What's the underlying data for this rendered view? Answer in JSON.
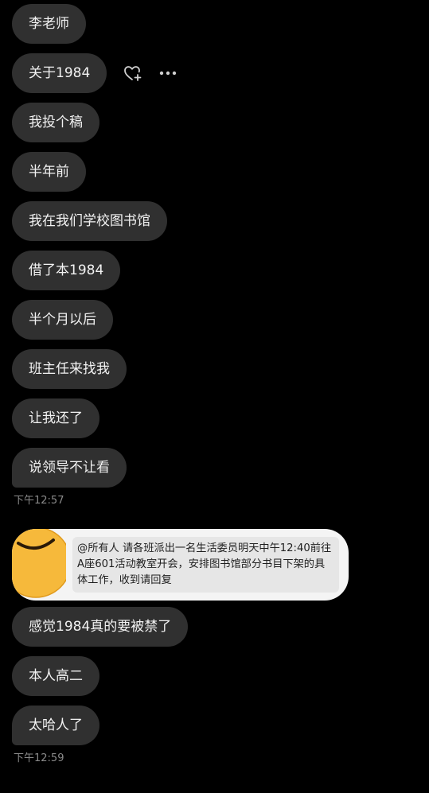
{
  "messages_group_1": [
    {
      "text": "李老师"
    },
    {
      "text": "关于1984"
    },
    {
      "text": "我投个稿"
    },
    {
      "text": "半年前"
    },
    {
      "text": "我在我们学校图书馆"
    },
    {
      "text": "借了本1984"
    },
    {
      "text": "半个月以后"
    },
    {
      "text": "班主任来找我"
    },
    {
      "text": "让我还了"
    },
    {
      "text": "说领导不让看"
    }
  ],
  "timestamp_1": "下午12:57",
  "quoted_notice": {
    "text": "@所有人  请各班派出一名生活委员明天中午12:40前往A座601活动教室开会，安排图书馆部分书目下架的具体工作，收到请回复"
  },
  "messages_group_2": [
    {
      "text": "感觉1984真的要被禁了"
    },
    {
      "text": "本人高二"
    },
    {
      "text": "太哈人了"
    }
  ],
  "timestamp_2": "下午12:59",
  "actions": {
    "like_icon": "heart-plus-icon",
    "more_icon": "more-dots-icon"
  },
  "colors": {
    "background": "#000000",
    "bubble": "#303030",
    "bubble_text": "#f2f2f2",
    "timestamp": "#8a8a8a",
    "quote_card": "#f4f4f4",
    "quote_inner": "#e6e6e6",
    "emoji": "#f6b93b"
  }
}
